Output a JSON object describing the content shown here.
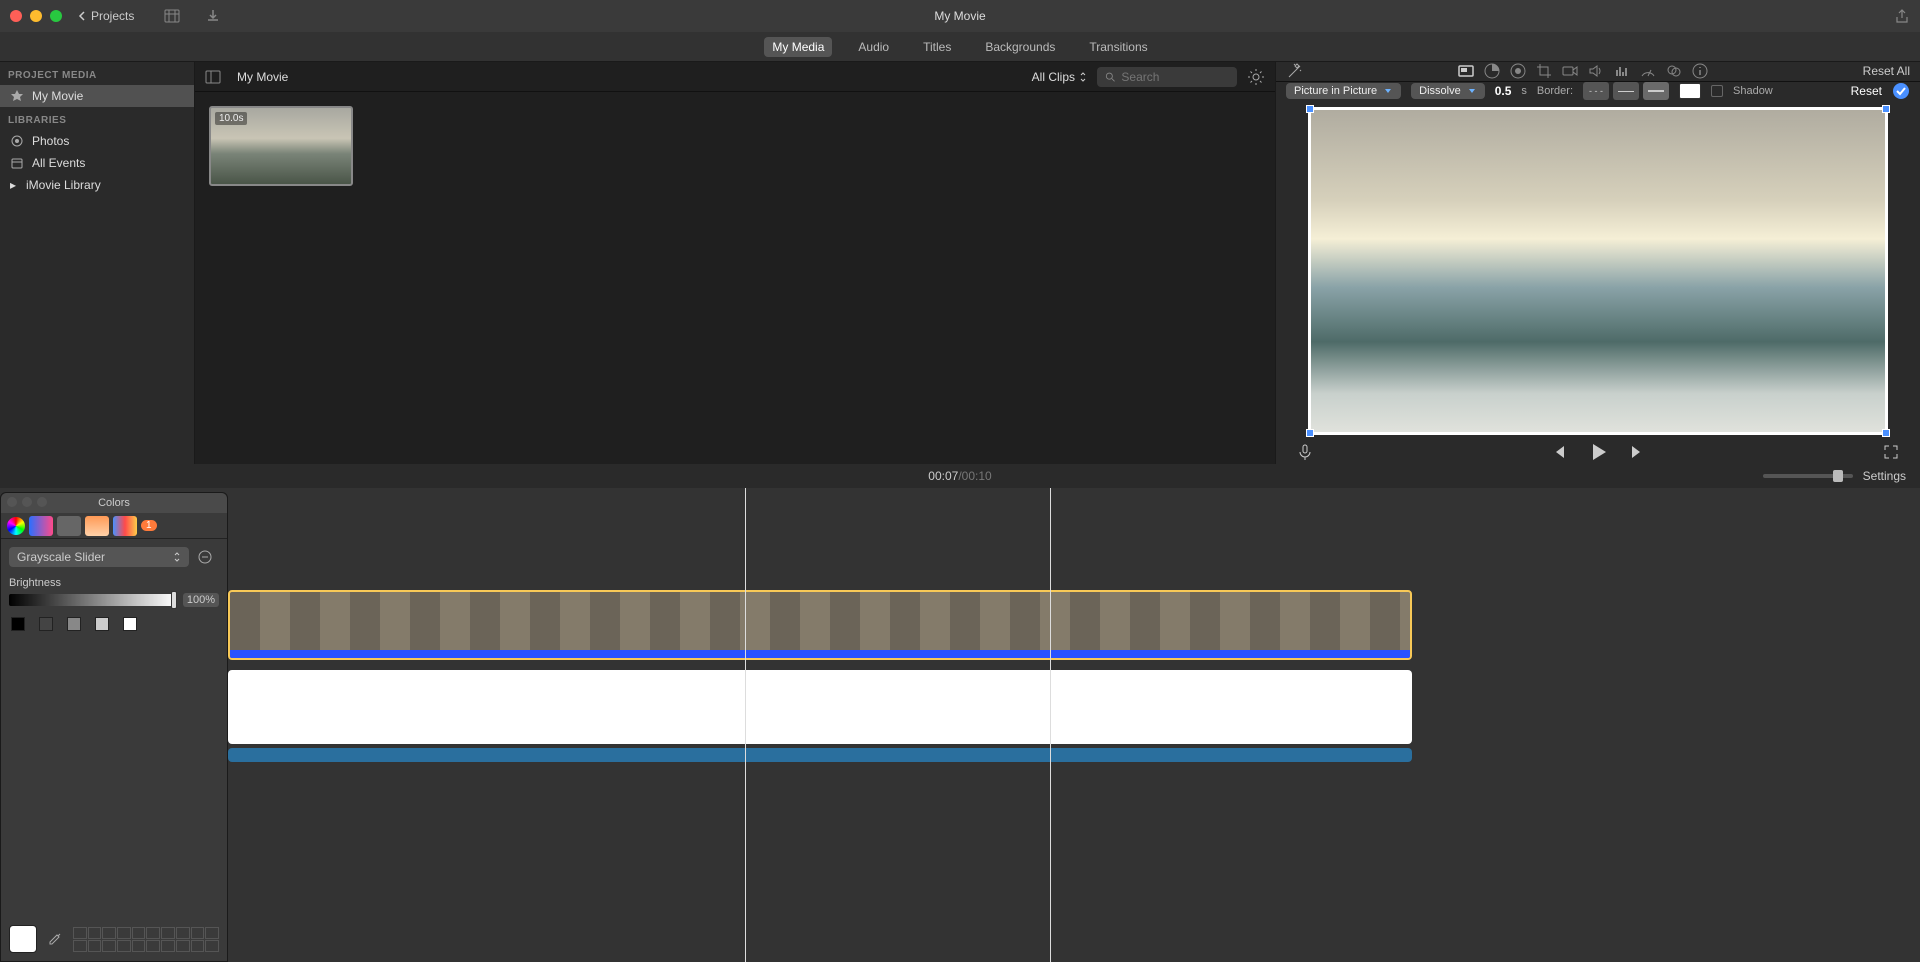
{
  "titlebar": {
    "projects": "Projects",
    "title": "My Movie"
  },
  "tabs": {
    "my_media": "My Media",
    "audio": "Audio",
    "titles": "Titles",
    "backgrounds": "Backgrounds",
    "transitions": "Transitions"
  },
  "sidebar": {
    "project_media_head": "PROJECT MEDIA",
    "my_movie": "My Movie",
    "libraries_head": "LIBRARIES",
    "photos": "Photos",
    "all_events": "All Events",
    "imovie_library": "iMovie Library"
  },
  "browser": {
    "breadcrumb": "My Movie",
    "all_clips": "All Clips",
    "search_placeholder": "Search",
    "thumb_duration": "10.0s"
  },
  "viewer": {
    "reset_all": "Reset All",
    "pip": "Picture in Picture",
    "dissolve": "Dissolve",
    "value": "0.5",
    "unit": "s",
    "border_label": "Border:",
    "none": "- - -",
    "shadow": "Shadow",
    "reset": "Reset"
  },
  "timeline": {
    "current": "00:07",
    "sep": " / ",
    "total": "00:10",
    "settings": "Settings"
  },
  "colors": {
    "title": "Colors",
    "badge": "1",
    "mode": "Grayscale Slider",
    "brightness_label": "Brightness",
    "brightness_value": "100%"
  }
}
